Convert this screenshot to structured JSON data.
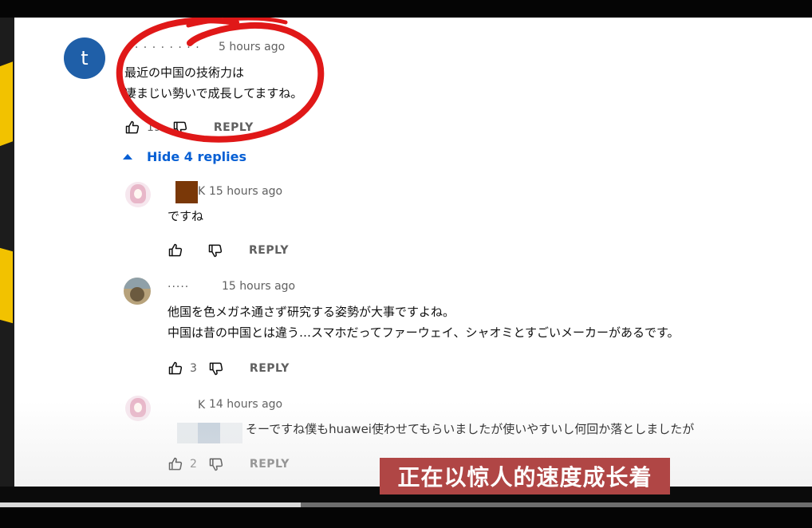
{
  "comments": [
    {
      "author": "· · · · · · · · ·",
      "avatar_letter": "t",
      "timestamp": "5 hours ago",
      "lines": [
        "最近の中国の技術力は",
        "凄まじい勢いで成長してますね。"
      ],
      "likes": "19",
      "reply_label": "REPLY"
    }
  ],
  "replies_toggle": "Hide 4 replies",
  "replies": [
    {
      "author": "K",
      "timestamp": "15 hours ago",
      "lines": [
        "ですね"
      ],
      "likes": "",
      "reply_label": "REPLY"
    },
    {
      "author": "·····",
      "timestamp": "15 hours ago",
      "lines": [
        "他国を色メガネ通さず研究する姿勢が大事ですよね。",
        "中国は昔の中国とは違う…スマホだってファーウェイ、シャオミとすごいメーカーがあるです。"
      ],
      "likes": "3",
      "reply_label": "REPLY"
    },
    {
      "author": "K",
      "timestamp": "14 hours ago",
      "lines": [
        "そーですね僕もhuawei使わせてもらいましたが使いやすいし何回か落としましたが"
      ],
      "likes": "2",
      "reply_label": "REPLY"
    }
  ],
  "subtitle": "正在以惊人的速度成长着",
  "video_progress": 0.37,
  "colors": {
    "link_blue": "#065fd4",
    "annotation_red": "#e01818",
    "subtitle_bg": "#b04645",
    "avatar_blue": "#1f5fa8"
  },
  "icons": [
    "thumb-up-icon",
    "thumb-down-icon",
    "caret-up-icon"
  ]
}
